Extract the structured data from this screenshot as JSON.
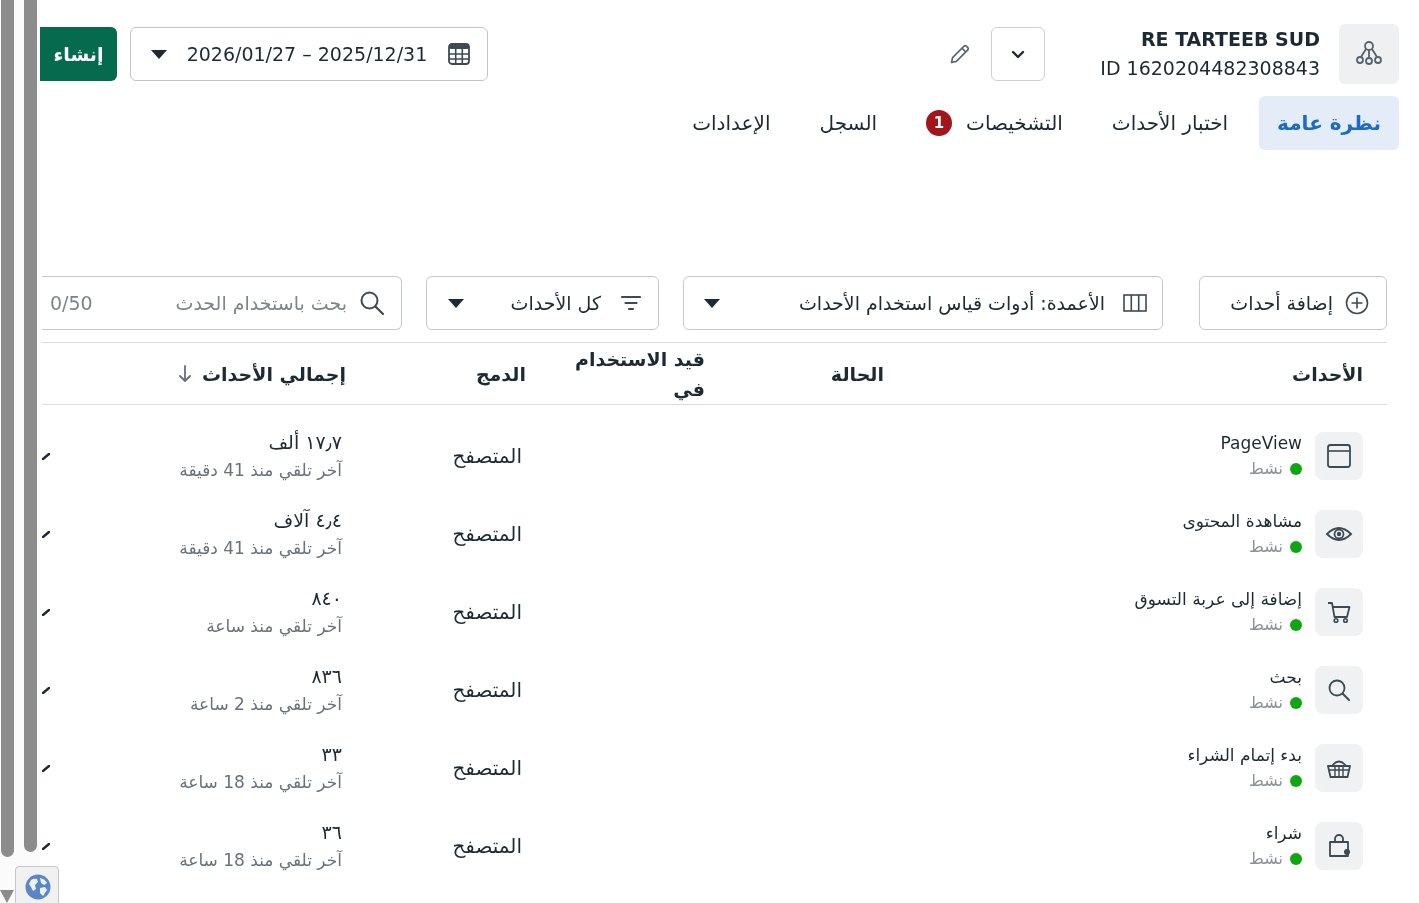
{
  "header": {
    "account": {
      "name": "RE TARTEEB SUD",
      "id": "ID 1620204482308843"
    },
    "date_range": "2026/01/27 – 2025/12/31",
    "create_button": "إنشاء"
  },
  "tabs": [
    {
      "label": "نظرة عامة",
      "selected": true
    },
    {
      "label": "اختبار الأحداث",
      "selected": false
    },
    {
      "label": "التشخيصات",
      "selected": false,
      "badge": "1"
    },
    {
      "label": "السجل",
      "selected": false
    },
    {
      "label": "الإعدادات",
      "selected": false
    }
  ],
  "toolbar": {
    "add_button": "إضافة أحداث",
    "columns_dropdown": "الأعمدة: أدوات قياس استخدام الأحداث",
    "filter_dropdown": "كل الأحداث",
    "search": {
      "placeholder": "بحث باستخدام الحدث",
      "counter": "0/50"
    }
  },
  "table": {
    "columns": [
      {
        "label": "الأحداث",
        "sorted": false
      },
      {
        "label": "الحالة",
        "sorted": false
      },
      {
        "label": "قيد الاستخدام في",
        "sorted": false
      },
      {
        "label": "الدمج",
        "sorted": false
      },
      {
        "label": "إجمالي الأحداث",
        "sorted": true
      }
    ],
    "rows": [
      {
        "event": "PageView",
        "status": "نشط",
        "color": "#11a611",
        "integration": "المتصفح",
        "total": "١٧٫٧ ألف",
        "last_received": "آخر تلقي منذ 41 دقيقة"
      },
      {
        "event": "مشاهدة المحتوى",
        "status": "نشط",
        "color": "#11a611",
        "integration": "المتصفح",
        "total": "٤٫٤ آلاف",
        "last_received": "آخر تلقي منذ 41 دقيقة"
      },
      {
        "event": "إضافة إلى عربة التسوق",
        "status": "نشط",
        "color": "#11a611",
        "integration": "المتصفح",
        "total": "٨٤٠",
        "last_received": "آخر تلقي منذ ساعة"
      },
      {
        "event": "بحث",
        "status": "نشط",
        "color": "#11a611",
        "integration": "المتصفح",
        "total": "٨٣٦",
        "last_received": "آخر تلقي منذ 2 ساعة"
      },
      {
        "event": "بدء إتمام الشراء",
        "status": "نشط",
        "color": "#11a611",
        "integration": "المتصفح",
        "total": "٣٣",
        "last_received": "آخر تلقي منذ 18 ساعة"
      },
      {
        "event": "شراء",
        "status": "نشط",
        "color": "#11a611",
        "integration": "المتصفح",
        "total": "٣٦",
        "last_received": "آخر تلقي منذ 18 ساعة"
      }
    ]
  }
}
